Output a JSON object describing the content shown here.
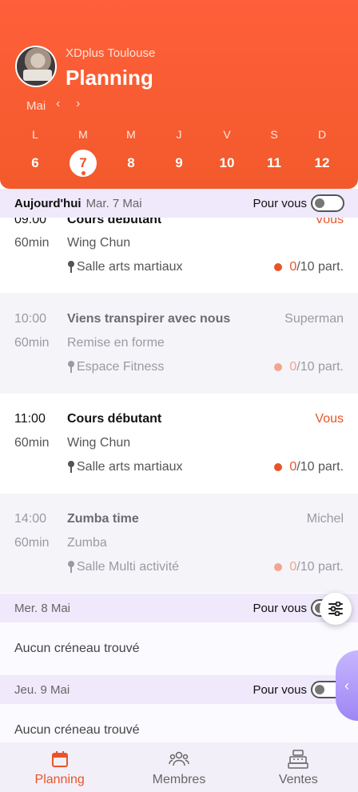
{
  "header": {
    "club_name": "XDplus Toulouse",
    "title": "Planning",
    "month": "Mai",
    "prev_icon": "chevron-left",
    "next_icon": "chevron-right",
    "brand_color": "#f25a2b"
  },
  "week": [
    {
      "letter": "L",
      "num": "6",
      "selected": false
    },
    {
      "letter": "M",
      "num": "7",
      "selected": true
    },
    {
      "letter": "M",
      "num": "8",
      "selected": false
    },
    {
      "letter": "J",
      "num": "9",
      "selected": false
    },
    {
      "letter": "V",
      "num": "10",
      "selected": false
    },
    {
      "letter": "S",
      "num": "11",
      "selected": false
    },
    {
      "letter": "D",
      "num": "12",
      "selected": false
    }
  ],
  "sections": [
    {
      "label_strong": "Aujourd'hui",
      "date": "Mar. 7 Mai",
      "pour_vous": "Pour vous"
    },
    {
      "date": "Mer. 8 Mai",
      "pour_vous": "Pour vous"
    },
    {
      "date": "Jeu. 9 Mai",
      "pour_vous": "Pour vous"
    }
  ],
  "sessions": [
    {
      "time": "09:00",
      "duration": "60min",
      "title": "Cours débutant",
      "category": "Wing Chun",
      "room": "Salle arts martiaux",
      "coach": "Vous",
      "booked": "0",
      "capacity": "/10 part.",
      "state": "active"
    },
    {
      "time": "10:00",
      "duration": "60min",
      "title": "Viens transpirer avec nous",
      "category": "Remise en forme",
      "room": "Espace Fitness",
      "coach": "Superman",
      "booked": "0",
      "capacity": "/10 part.",
      "state": "past"
    },
    {
      "time": "11:00",
      "duration": "60min",
      "title": "Cours débutant",
      "category": "Wing Chun",
      "room": "Salle arts martiaux",
      "coach": "Vous",
      "booked": "0",
      "capacity": "/10 part.",
      "state": "active"
    },
    {
      "time": "14:00",
      "duration": "60min",
      "title": "Zumba time",
      "category": "Zumba",
      "room": "Salle Multi activité",
      "coach": "Michel",
      "booked": "0",
      "capacity": "/10 part.",
      "state": "past"
    }
  ],
  "empty": {
    "wed": "Aucun créneau trouvé",
    "thu": "Aucun créneau trouvé"
  },
  "fab": {
    "filter_icon": "sliders-icon",
    "side_icon": "chevron-left"
  },
  "nav": [
    {
      "label": "Planning",
      "icon": "calendar-icon",
      "active": true
    },
    {
      "label": "Membres",
      "icon": "users-icon",
      "active": false
    },
    {
      "label": "Ventes",
      "icon": "cash-register-icon",
      "active": false
    }
  ],
  "colors": {
    "accent": "#e8542a",
    "section_bg": "#efe9fb",
    "side_tab": "#9d86f5"
  }
}
